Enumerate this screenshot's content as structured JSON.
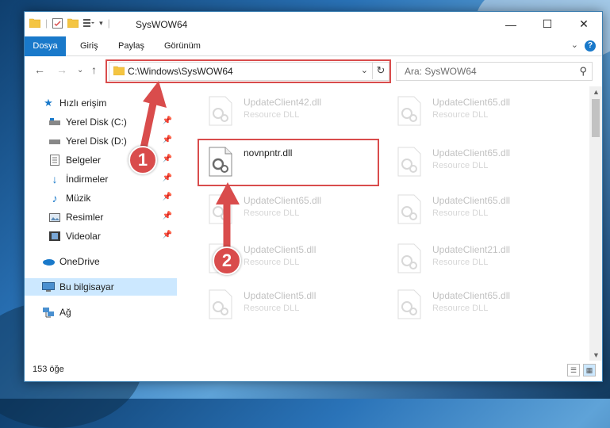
{
  "window": {
    "title": "SysWOW64"
  },
  "ribbon": {
    "tabs": [
      "Dosya",
      "Giriş",
      "Paylaş",
      "Görünüm"
    ],
    "help_label": "?"
  },
  "address": {
    "path": "C:\\Windows\\SysWOW64"
  },
  "search": {
    "placeholder": "Ara: SysWOW64"
  },
  "nav": {
    "items": [
      {
        "label": "Hızlı erişim",
        "icon": "star-icon"
      },
      {
        "label": "Yerel Disk (C:)",
        "icon": "drive-icon"
      },
      {
        "label": "Yerel Disk (D:)",
        "icon": "drive-icon"
      },
      {
        "label": "Belgeler",
        "icon": "documents-icon"
      },
      {
        "label": "İndirmeler",
        "icon": "download-icon"
      },
      {
        "label": "Müzik",
        "icon": "music-icon"
      },
      {
        "label": "Resimler",
        "icon": "pictures-icon"
      },
      {
        "label": "Videolar",
        "icon": "videos-icon"
      },
      {
        "label": "OneDrive",
        "icon": "cloud-icon"
      },
      {
        "label": "Bu bilgisayar",
        "icon": "computer-icon"
      },
      {
        "label": "Ağ",
        "icon": "network-icon"
      }
    ]
  },
  "files": {
    "left": [
      {
        "name": "UpdateClient42.dll",
        "type": "Resource DLL"
      },
      {
        "name": "novnpntr.dll",
        "type": ""
      },
      {
        "name": "UpdateClient65.dll",
        "type": "Resource DLL"
      },
      {
        "name": "UpdateClient5.dll",
        "type": "Resource DLL"
      },
      {
        "name": "UpdateClient5.dll",
        "type": "Resource DLL"
      }
    ],
    "right": [
      {
        "name": "UpdateClient65.dll",
        "type": "Resource DLL"
      },
      {
        "name": "UpdateClient65.dll",
        "type": "Resource DLL"
      },
      {
        "name": "UpdateClient65.dll",
        "type": "Resource DLL"
      },
      {
        "name": "UpdateClient21.dll",
        "type": "Resource DLL"
      },
      {
        "name": "UpdateClient65.dll",
        "type": "Resource DLL"
      }
    ]
  },
  "status": {
    "count": "153 öğe"
  },
  "annotations": {
    "step1": "1",
    "step2": "2",
    "color": "#d94c4c"
  }
}
